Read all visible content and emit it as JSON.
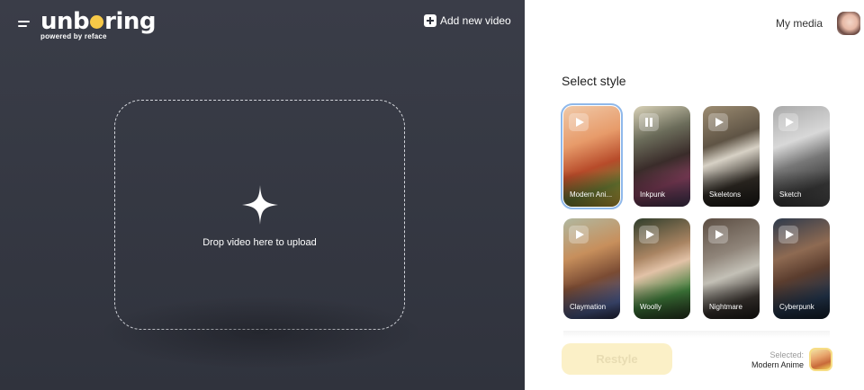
{
  "header": {
    "logo_text": "unboring",
    "logo_subtitle": "powered by reface",
    "add_video_label": "Add new video"
  },
  "upload": {
    "drop_text": "Drop video here to upload"
  },
  "account": {
    "my_media_label": "My media"
  },
  "styles": {
    "title": "Select style",
    "items": [
      {
        "label": "Modern Ani...",
        "state": "selected"
      },
      {
        "label": "Inkpunk",
        "state": "playing"
      },
      {
        "label": "Skeletons",
        "state": "idle"
      },
      {
        "label": "Sketch",
        "state": "idle"
      },
      {
        "label": "Claymation",
        "state": "idle"
      },
      {
        "label": "Woolly",
        "state": "idle"
      },
      {
        "label": "Nightmare",
        "state": "idle"
      },
      {
        "label": "Cyberpunk",
        "state": "idle"
      }
    ]
  },
  "footer": {
    "restyle_label": "Restyle",
    "selected_label": "Selected:",
    "selected_value": "Modern Anime"
  },
  "colors": {
    "left_panel_bg": "#353843",
    "accent_yellow": "#f7c948",
    "restyle_bg_disabled": "#fbf0c7",
    "selected_outline": "#8fb8ea"
  }
}
